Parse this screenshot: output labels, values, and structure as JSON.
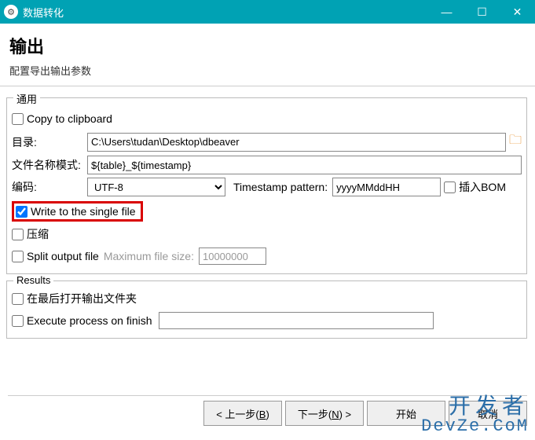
{
  "window": {
    "title": "数据转化",
    "minimize": "—",
    "maximize": "☐",
    "close": "✕"
  },
  "header": {
    "title": "输出",
    "subtitle": "配置导出输出参数"
  },
  "general": {
    "group_title": "通用",
    "copy_clipboard": "Copy to clipboard",
    "copy_clipboard_checked": false,
    "dir_label": "目录:",
    "dir_value": "C:\\Users\\tudan\\Desktop\\dbeaver",
    "pattern_label": "文件名称模式:",
    "pattern_value": "${table}_${timestamp}",
    "encoding_label": "编码:",
    "encoding_value": "UTF-8",
    "ts_label": "Timestamp pattern:",
    "ts_value": "yyyyMMddHH",
    "bom_label": "插入BOM",
    "bom_checked": false,
    "single_file_label": "Write to the single file",
    "single_file_checked": true,
    "compress_label": "压缩",
    "compress_checked": false,
    "split_label": "Split output file",
    "split_checked": false,
    "maxfs_label": "Maximum file size:",
    "maxfs_value": "10000000"
  },
  "results": {
    "group_title": "Results",
    "open_folder_label": "在最后打开输出文件夹",
    "open_folder_checked": false,
    "exec_label": "Execute process on finish",
    "exec_checked": false,
    "exec_value": ""
  },
  "buttons": {
    "back": "< 上一步(B)",
    "back_key": "B",
    "next": "下一步(N) >",
    "next_key": "N",
    "start": "开始",
    "cancel": "取消"
  },
  "watermark": {
    "cn": "开发者",
    "en": "DevZe.CoM"
  }
}
